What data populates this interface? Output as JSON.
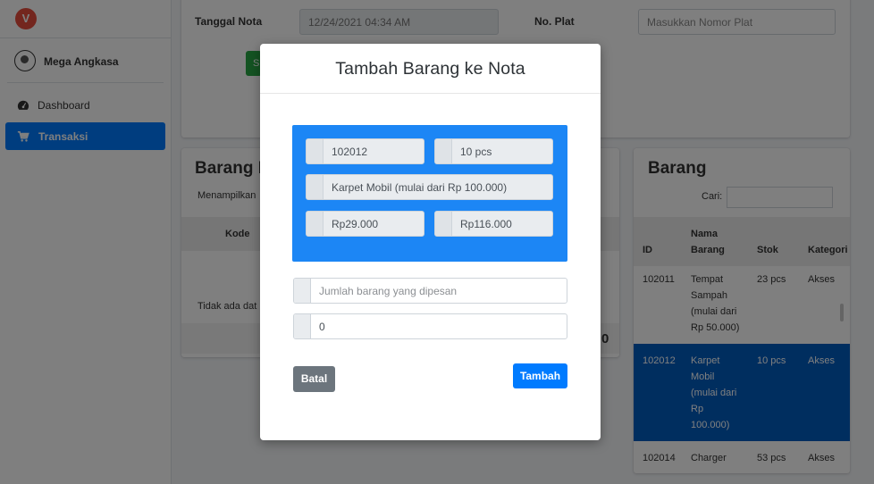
{
  "brand": {
    "logo_letter": "V"
  },
  "user": {
    "name": "Mega Angkasa"
  },
  "nav": {
    "dashboard_label": "Dashboard",
    "transaksi_label": "Transaksi"
  },
  "header_form": {
    "tanggal_label": "Tanggal Nota",
    "tanggal_value": "12/24/2021 04:34 AM",
    "plat_label": "No. Plat",
    "plat_placeholder": "Masukkan Nomor Plat",
    "green_btn_text": "S"
  },
  "left_card": {
    "title": "Barang D",
    "showing_text": "Menampilkan",
    "col_kode": "Kode",
    "empty_text": "Tidak ada dat",
    "right_digit": "0"
  },
  "right_card": {
    "title": "Barang",
    "search_label": "Cari:",
    "columns": [
      "ID",
      "Nama Barang",
      "Stok",
      "Kategori"
    ],
    "rows": [
      {
        "id": "102011",
        "nama": [
          "Tempat",
          "Sampah",
          "(mulai dari",
          "Rp 50.000)"
        ],
        "stok": "23 pcs",
        "kategori": "Akses"
      },
      {
        "id": "102012",
        "nama": [
          "Karpet",
          "Mobil",
          "(mulai dari",
          "Rp",
          "100.000)"
        ],
        "stok": "10 pcs",
        "kategori": "Akses"
      },
      {
        "id": "102014",
        "nama": [
          "Charger"
        ],
        "stok": "53 pcs",
        "kategori": "Akses"
      }
    ]
  },
  "modal": {
    "title": "Tambah Barang ke Nota",
    "kode": "102012",
    "stok": "10 pcs",
    "nama": "Karpet Mobil (mulai dari Rp 100.000)",
    "harga": "Rp29.000",
    "total": "Rp116.000",
    "jumlah_placeholder": "Jumlah barang yang dipesan",
    "diskon_value": "0",
    "batal_label": "Batal",
    "tambah_label": "Tambah"
  },
  "colors": {
    "primary": "#007bff",
    "info_box": "#1c86f5",
    "secondary": "#6c757d",
    "success": "#28a745",
    "brand_logo": "#e74c3c",
    "selected_row": "#005cbf"
  }
}
